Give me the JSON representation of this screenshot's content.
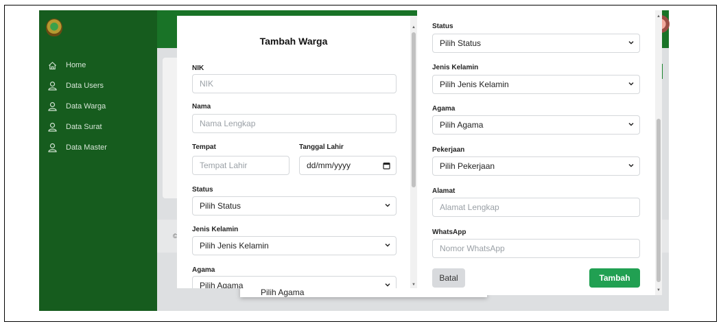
{
  "sidebar": {
    "items": [
      {
        "label": "Home",
        "icon": "home-icon"
      },
      {
        "label": "Data Users",
        "icon": "user-icon"
      },
      {
        "label": "Data Warga",
        "icon": "user-icon"
      },
      {
        "label": "Data Surat",
        "icon": "user-icon"
      },
      {
        "label": "Data Master",
        "icon": "user-icon"
      }
    ]
  },
  "footer": {
    "char": "©"
  },
  "ghost_dropdown": {
    "label": "Pilih Agama"
  },
  "modal": {
    "title": "Tambah Warga",
    "nik": {
      "label": "NIK",
      "placeholder": "NIK"
    },
    "nama": {
      "label": "Nama",
      "placeholder": "Nama Lengkap"
    },
    "tempat": {
      "label": "Tempat",
      "placeholder": "Tempat Lahir"
    },
    "tanggal": {
      "label": "Tanggal Lahir",
      "placeholder": "dd/mm/yyyy"
    },
    "status": {
      "label": "Status",
      "value": "Pilih Status"
    },
    "jenis_kelamin": {
      "label": "Jenis Kelamin",
      "value": "Pilih Jenis Kelamin"
    },
    "agama": {
      "label": "Agama",
      "value": "Pilih Agama"
    },
    "pekerjaan": {
      "label": "Pekerjaan",
      "value": "Pilih Pekerjaan"
    },
    "alamat": {
      "label": "Alamat",
      "placeholder": "Alamat Lengkap"
    },
    "whatsapp": {
      "label": "WhatsApp",
      "placeholder": "Nomor WhatsApp"
    },
    "batal_label": "Batal",
    "tambah_label": "Tambah"
  },
  "colors": {
    "sidebar": "#165c1e",
    "topbar": "#1b7a2a",
    "primary": "#21a052"
  }
}
